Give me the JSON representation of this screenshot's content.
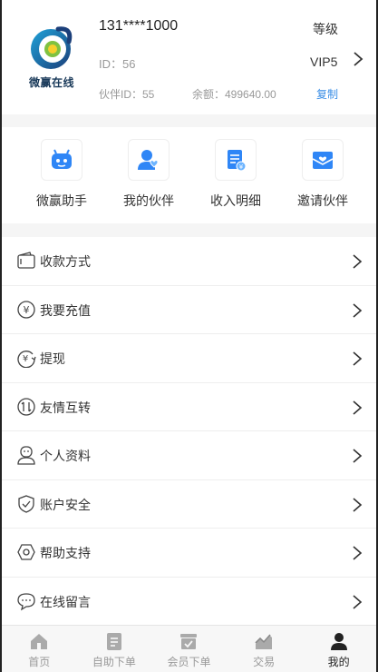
{
  "profile": {
    "phone": "131****1000",
    "level_label": "等级",
    "id_text": "ID：56",
    "vip": "VIP5",
    "partner_id": "伙伴ID：55",
    "balance": "余额：499640.00",
    "copy_label": "复制",
    "logo_text": "微赢在线"
  },
  "actions": [
    {
      "label": "微赢助手",
      "icon": "robot-icon"
    },
    {
      "label": "我的伙伴",
      "icon": "partner-icon"
    },
    {
      "label": "收入明细",
      "icon": "income-detail-icon"
    },
    {
      "label": "邀请伙伴",
      "icon": "invite-envelope-icon"
    }
  ],
  "menu": [
    {
      "label": "收款方式",
      "icon": "wallet-icon"
    },
    {
      "label": "我要充值",
      "icon": "yuan-circle-icon"
    },
    {
      "label": "提现",
      "icon": "withdraw-icon"
    },
    {
      "label": "友情互转",
      "icon": "transfer-icon"
    },
    {
      "label": "个人资料",
      "icon": "user-profile-icon"
    },
    {
      "label": "账户安全",
      "icon": "shield-icon"
    },
    {
      "label": "帮助支持",
      "icon": "help-hexagon-icon"
    },
    {
      "label": "在线留言",
      "icon": "chat-bubble-icon"
    }
  ],
  "tabs": [
    {
      "label": "首页",
      "icon": "home-icon",
      "active": false
    },
    {
      "label": "自助下单",
      "icon": "self-order-icon",
      "active": false
    },
    {
      "label": "会员下单",
      "icon": "member-order-icon",
      "active": false
    },
    {
      "label": "交易",
      "icon": "trade-chart-icon",
      "active": false
    },
    {
      "label": "我的",
      "icon": "user-icon",
      "active": true
    }
  ],
  "colors": {
    "accent": "#3a8ee6",
    "icon_blue": "#2f86f6",
    "active_tab": "#222222",
    "inactive_tab": "#999999"
  }
}
